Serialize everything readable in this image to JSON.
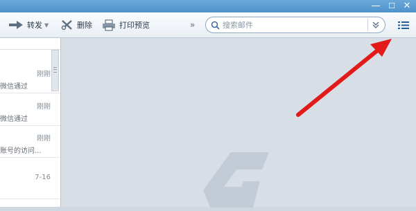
{
  "window": {
    "minimize_glyph": "—",
    "maximize_glyph": "☐",
    "close_glyph": "✕"
  },
  "toolbar": {
    "forward_label": "转发",
    "delete_label": "删除",
    "print_label": "打印预览",
    "more_glyph": "»",
    "list_view_icon": "list-icon"
  },
  "search": {
    "placeholder": "搜索邮件"
  },
  "messages": [
    {
      "time": "刚刚",
      "preview": "微信通过"
    },
    {
      "time": "刚刚",
      "preview": "微信通过"
    },
    {
      "time": "刚刚",
      "preview": "账号的访问..."
    },
    {
      "time": "7-16",
      "preview": ""
    }
  ],
  "reading_pane": {
    "watermark": "G-logo",
    "background": "#d7dee5"
  },
  "annotation": {
    "arrow_color": "#e21a1a"
  },
  "colors": {
    "titlebar": "#4f93cd",
    "accent": "#2c7fc4"
  }
}
